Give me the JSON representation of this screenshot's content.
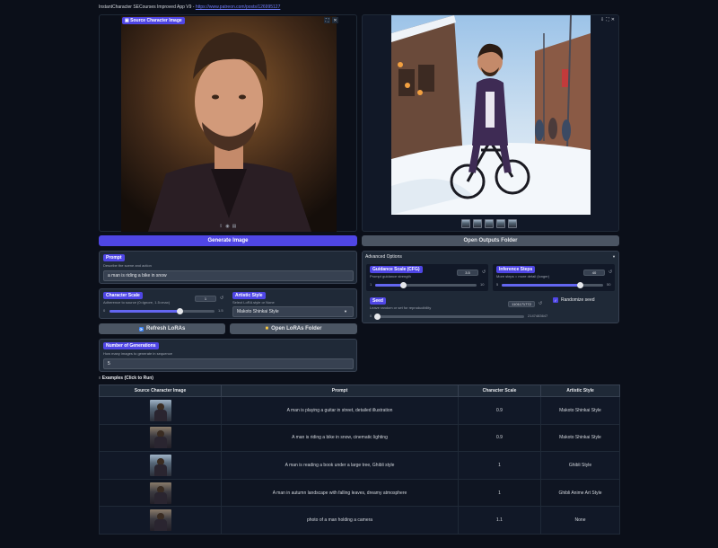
{
  "app_title": "InstantCharacter SECourses Improved App V9 - ",
  "app_link": "https://www.patreon.com/posts/126995127",
  "source_panel": {
    "label": "Source Character Image"
  },
  "output_panel": {
    "thumbnail_count": 5
  },
  "buttons": {
    "generate": "Generate Image",
    "open_outputs": "Open Outputs Folder",
    "refresh_loras": "Refresh LoRAs",
    "open_loras": "Open LoRAs Folder"
  },
  "prompt": {
    "label": "Prompt",
    "description": "Describe the scene and action",
    "value": "a man is riding a bike in snow"
  },
  "character_scale": {
    "label": "Character Scale",
    "description": "Adherence to source (0=ignore, 1.5=max)",
    "value": "1",
    "min": "0",
    "max": "1.5",
    "fraction": 0.667
  },
  "artistic_style": {
    "label": "Artistic Style",
    "description": "Select LoRA style or None",
    "value": "Makoto Shinkai Style"
  },
  "generations": {
    "label": "Number of Generations",
    "description": "How many images to generate in sequence",
    "value": "5"
  },
  "advanced": {
    "title": "Advanced Options",
    "guidance": {
      "label": "Guidance Scale (CFG)",
      "description": "Prompt guidance strength",
      "value": "3.5",
      "min": "1",
      "max": "10",
      "fraction": 0.278
    },
    "steps": {
      "label": "Inference Steps",
      "description": "More steps = more detail (longer)",
      "value": "40",
      "min": "5",
      "max": "50",
      "fraction": 0.778
    },
    "seed": {
      "label": "Seed",
      "description": "Leave random or set for reproducibility",
      "value": "1101171772",
      "min": "0",
      "max": "2147483647",
      "fraction": 0.005
    },
    "randomize": {
      "label": "Randomize seed",
      "checked": true
    }
  },
  "examples": {
    "title": "Examples (Click to Run)",
    "headers": [
      "Source Character Image",
      "Prompt",
      "Character Scale",
      "Artistic Style"
    ],
    "rows": [
      {
        "prompt": "A man is playing a guitar in street, detailed illustration",
        "scale": "0.9",
        "style": "Makoto Shinkai Style"
      },
      {
        "prompt": "A man is riding a bike in snow, cinematic lighting",
        "scale": "0.9",
        "style": "Makoto Shinkai Style"
      },
      {
        "prompt": "A man is reading a book under a large tree, Ghibli style",
        "scale": "1",
        "style": "Ghibli Style"
      },
      {
        "prompt": "A man in autumn landscape with falling leaves, dreamy atmosphere",
        "scale": "1",
        "style": "Ghibli Anime Art Style"
      },
      {
        "prompt": "photo of a man holding a camera",
        "scale": "1.1",
        "style": "None"
      }
    ]
  },
  "colors": {
    "accent": "#4f46e5",
    "background": "#0b0f19",
    "panel": "#1f2937"
  }
}
